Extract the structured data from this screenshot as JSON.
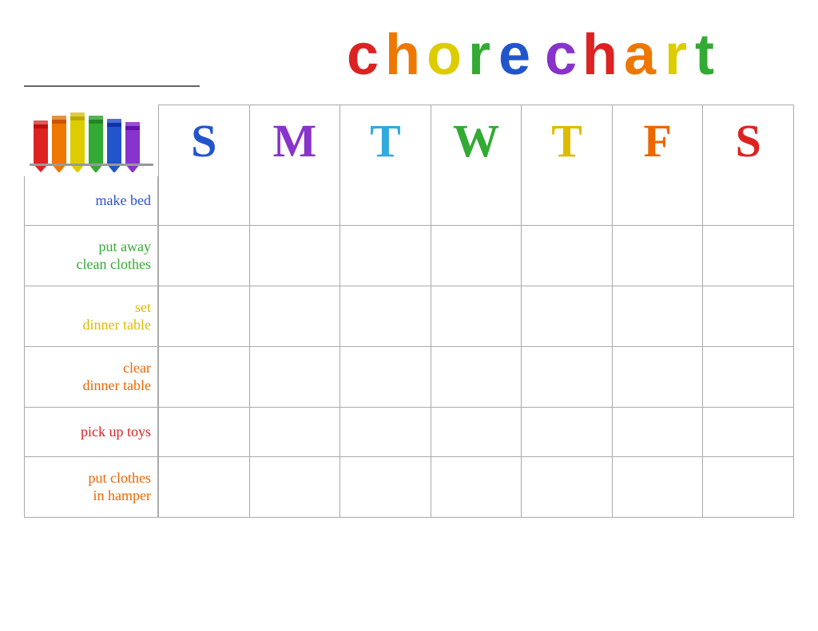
{
  "header": {
    "title": "chore chart",
    "name_line_label": "Name line"
  },
  "days": {
    "headers": [
      {
        "label": "S",
        "color": "#2255CC"
      },
      {
        "label": "M",
        "color": "#8833CC"
      },
      {
        "label": "T",
        "color": "#33AADD"
      },
      {
        "label": "W",
        "color": "#33AA33"
      },
      {
        "label": "T",
        "color": "#DDBB00"
      },
      {
        "label": "F",
        "color": "#EE6600"
      },
      {
        "label": "S",
        "color": "#DD2222"
      }
    ]
  },
  "chores": [
    {
      "label": "make bed",
      "color": "#2255CC",
      "row_class": "row-1"
    },
    {
      "label": "put away\nclean clothes",
      "color": "#33AA33",
      "row_class": "row-2"
    },
    {
      "label": "set\ndinner table",
      "color": "#DDBB00",
      "row_class": "row-3"
    },
    {
      "label": "clear\ndinner table",
      "color": "#EE6600",
      "row_class": "row-4"
    },
    {
      "label": "pick up toys",
      "color": "#DD2222",
      "row_class": "row-5"
    },
    {
      "label": "put clothes\nin hamper",
      "color": "#EE6600",
      "row_class": "row-6"
    }
  ],
  "crayons": {
    "colors": [
      "#DD2222",
      "#EE6600",
      "#DDCC00",
      "#33AA33",
      "#2255CC",
      "#8833CC"
    ]
  }
}
